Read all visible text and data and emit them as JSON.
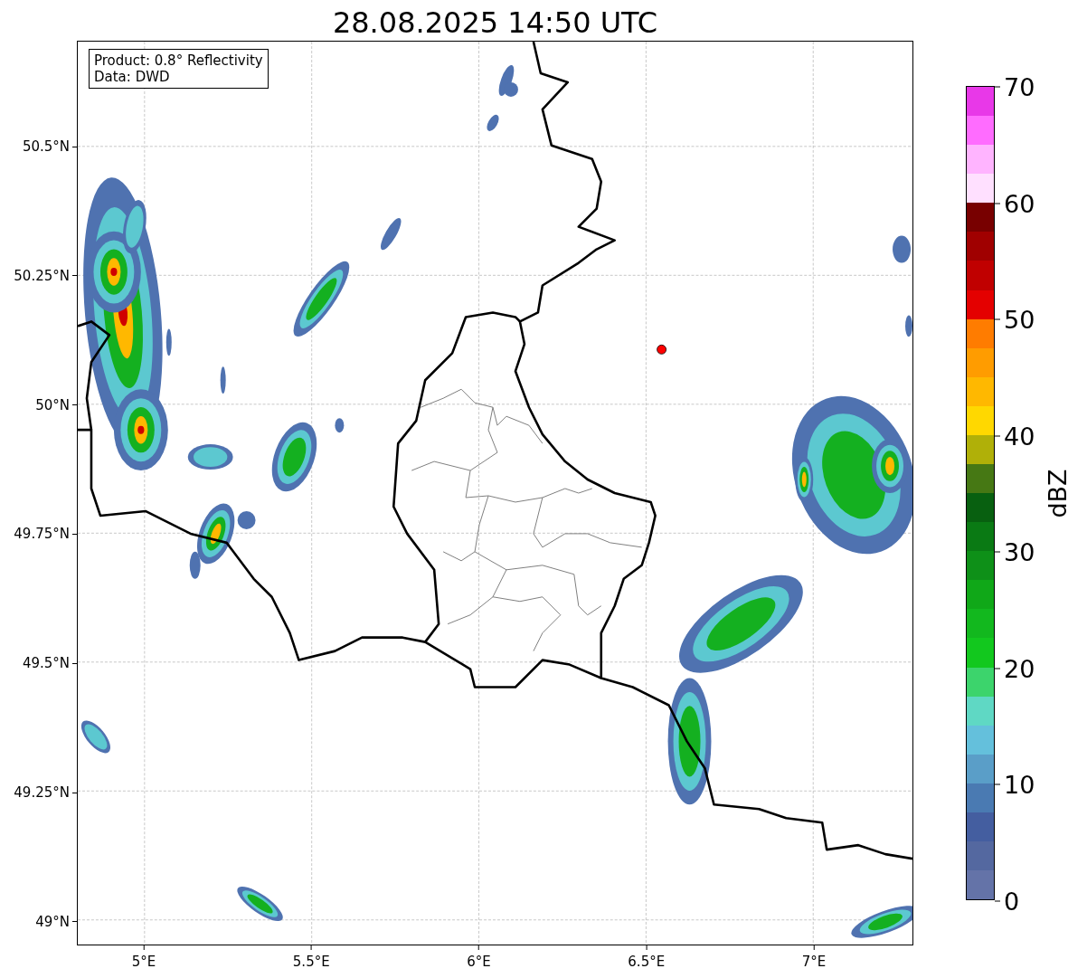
{
  "title": "28.08.2025 14:50 UTC",
  "map": {
    "info_box": [
      "Product: 0.8° Reflectivity",
      "Data: DWD"
    ],
    "yticks": [
      "50.5°N",
      "50.25°N",
      "50°N",
      "49.75°N",
      "49.5°N",
      "49.25°N",
      "49°N"
    ],
    "xticks": [
      "5°E",
      "5.5°E",
      "6°E",
      "6.5°E",
      "7°E"
    ]
  },
  "colorbar": {
    "label": "dBZ",
    "ticks": [
      "70",
      "60",
      "50",
      "40",
      "30",
      "20",
      "10",
      "0"
    ],
    "bins": [
      {
        "color": "#e838e8"
      },
      {
        "color": "#ff6cff"
      },
      {
        "color": "#ffb4ff"
      },
      {
        "color": "#ffe0ff"
      },
      {
        "color": "#780000"
      },
      {
        "color": "#a00000"
      },
      {
        "color": "#c00000"
      },
      {
        "color": "#e40000"
      },
      {
        "color": "#ff7c00"
      },
      {
        "color": "#ff9c00"
      },
      {
        "color": "#ffb800"
      },
      {
        "color": "#ffd800"
      },
      {
        "color": "#b0b008"
      },
      {
        "color": "#467814"
      },
      {
        "color": "#086010"
      },
      {
        "color": "#0a7a14"
      },
      {
        "color": "#0e9018"
      },
      {
        "color": "#10a818"
      },
      {
        "color": "#12b81e"
      },
      {
        "color": "#12c81e"
      },
      {
        "color": "#3cd46c"
      },
      {
        "color": "#5fd8c4"
      },
      {
        "color": "#64c0dc"
      },
      {
        "color": "#5a9ec8"
      },
      {
        "color": "#4a7ab2"
      },
      {
        "color": "#445ea0"
      },
      {
        "color": "#5468a0"
      },
      {
        "color": "#6473a8"
      }
    ]
  }
}
